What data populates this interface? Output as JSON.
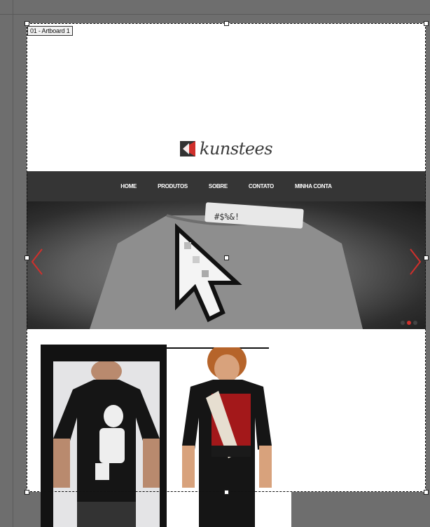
{
  "artboard": {
    "label": "01 - Artboard 1"
  },
  "site": {
    "logo_text": "kunstees",
    "nav": [
      {
        "label": "HOME"
      },
      {
        "label": "PRODUTOS"
      },
      {
        "label": "SOBRE"
      },
      {
        "label": "CONTATO"
      },
      {
        "label": "MINHA CONTA"
      }
    ],
    "hero": {
      "slides": 3,
      "active_slide": 2,
      "prev_icon": "chevron-left-icon",
      "next_icon": "chevron-right-icon"
    },
    "products": [
      {
        "image": "stormtrooper-tshirt-photo"
      },
      {
        "image": "walking-dead-tshirt-photo"
      }
    ]
  },
  "colors": {
    "nav_bg": "#353535",
    "accent": "#d0302c",
    "canvas": "#6e6e6e",
    "artboard_bg": "#ffffff"
  }
}
